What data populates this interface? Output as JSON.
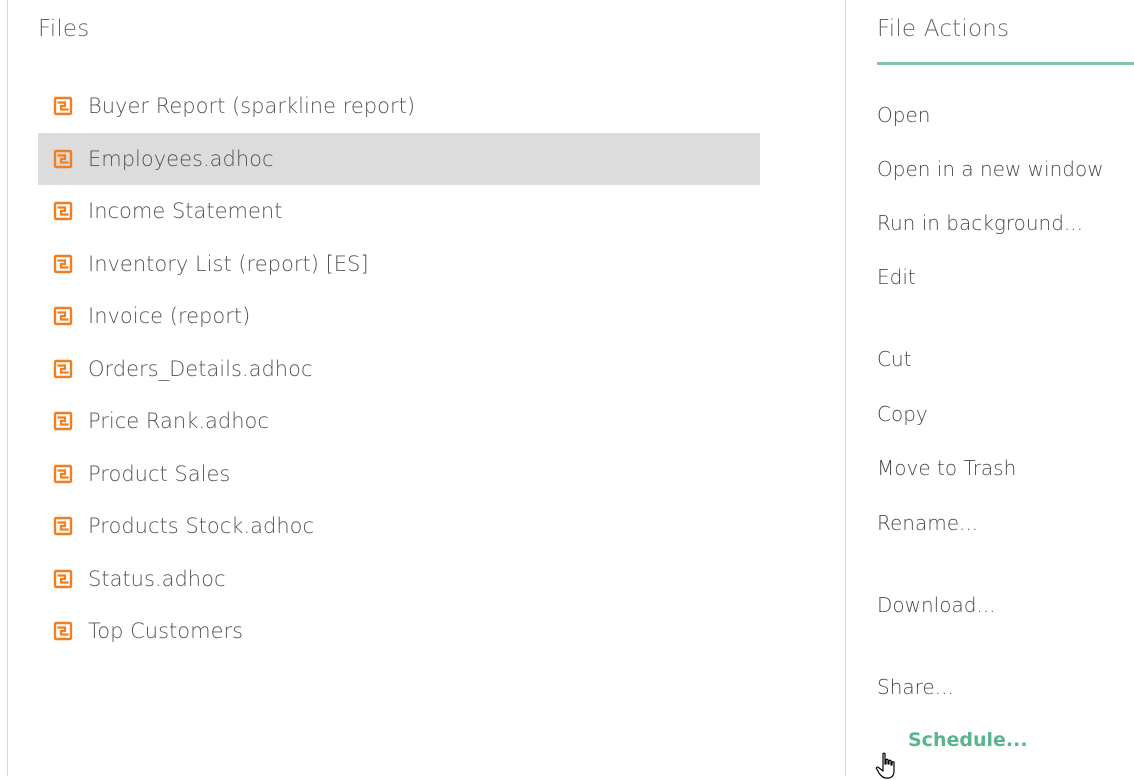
{
  "files_panel": {
    "title": "Files",
    "items": [
      {
        "label": "Buyer Report (sparkline report)",
        "icon": "report-icon"
      },
      {
        "label": "Employees.adhoc",
        "icon": "report-icon",
        "selected": true
      },
      {
        "label": "Income Statement",
        "icon": "report-icon"
      },
      {
        "label": "Inventory List (report) [ES]",
        "icon": "report-icon"
      },
      {
        "label": "Invoice (report)",
        "icon": "report-icon"
      },
      {
        "label": "Orders_Details.adhoc",
        "icon": "report-icon"
      },
      {
        "label": "Price Rank.adhoc",
        "icon": "report-icon"
      },
      {
        "label": "Product Sales",
        "icon": "report-icon"
      },
      {
        "label": "Products Stock.adhoc",
        "icon": "report-icon"
      },
      {
        "label": "Status.adhoc",
        "icon": "report-icon"
      },
      {
        "label": "Top Customers",
        "icon": "report-icon"
      }
    ]
  },
  "actions_panel": {
    "title": "File Actions",
    "items": [
      {
        "label": "Open"
      },
      {
        "label": "Open in a new window"
      },
      {
        "label": "Run in background..."
      },
      {
        "label": "Edit"
      },
      {
        "label": "Cut"
      },
      {
        "label": "Copy"
      },
      {
        "label": "Move to Trash"
      },
      {
        "label": "Rename..."
      },
      {
        "label": "Download..."
      },
      {
        "label": "Share..."
      },
      {
        "label": "Schedule...",
        "hovered": true
      }
    ]
  },
  "colors": {
    "icon_orange": "#f07f22",
    "accent_green": "#7fc4ad",
    "hover_green": "#58b58f",
    "selection_gray": "#dcdcdc"
  }
}
